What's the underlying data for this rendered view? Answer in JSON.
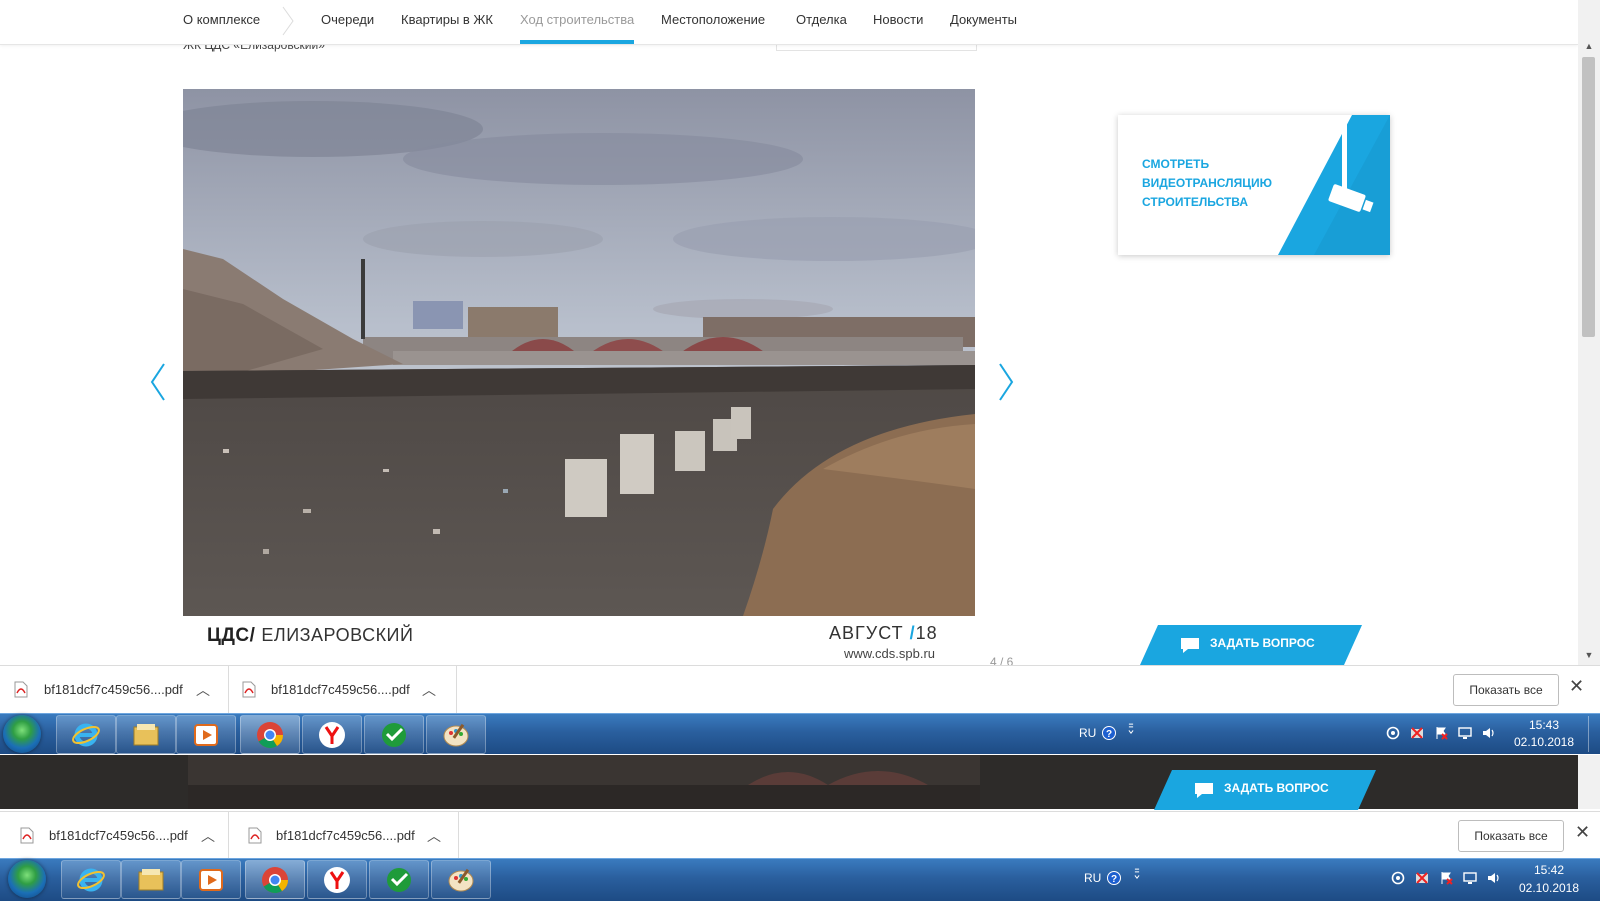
{
  "nav": {
    "items": [
      "О комплексе",
      "Очереди",
      "Квартиры в ЖК",
      "Ход строительства",
      "Местоположение",
      "Отделка",
      "Новости",
      "Документы"
    ],
    "active_index": 3
  },
  "page": {
    "subtitle": "ЖК ЦДС «Елизаровский»"
  },
  "gallery": {
    "brand_logo": "ЦДС",
    "brand_name": "ЕЛИЗАРОВСКИЙ",
    "month": "АВГУСТ",
    "year": "18",
    "url": "www.cds.spb.ru",
    "counter": "4 / 6"
  },
  "video_card": {
    "line1": "СМОТРЕТЬ",
    "line2": "ВИДЕОТРАНСЛЯЦИЮ",
    "line3": "СТРОИТЕЛЬСТВА"
  },
  "ask_button": {
    "label": "ЗАДАТЬ ВОПРОС"
  },
  "downloads": {
    "top": {
      "files": [
        "bf181dcf7c459c56....pdf",
        "bf181dcf7c459c56....pdf"
      ],
      "show_all": "Показать все"
    },
    "bottom": {
      "files": [
        "bf181dcf7c459c56....pdf",
        "bf181dcf7c459c56....pdf"
      ],
      "show_all": "Показать все"
    }
  },
  "taskbar_top": {
    "lang": "RU",
    "time": "15:43",
    "date": "02.10.2018",
    "apps": [
      "internet-explorer-icon",
      "file-explorer-icon",
      "media-player-icon",
      "chrome-icon",
      "yandex-browser-icon",
      "sberbank-icon",
      "paint-icon"
    ]
  },
  "taskbar_bottom": {
    "lang": "RU",
    "time": "15:42",
    "date": "02.10.2018"
  },
  "colors": {
    "accent": "#1aa6e0",
    "taskbar": "#2a5f9e"
  }
}
